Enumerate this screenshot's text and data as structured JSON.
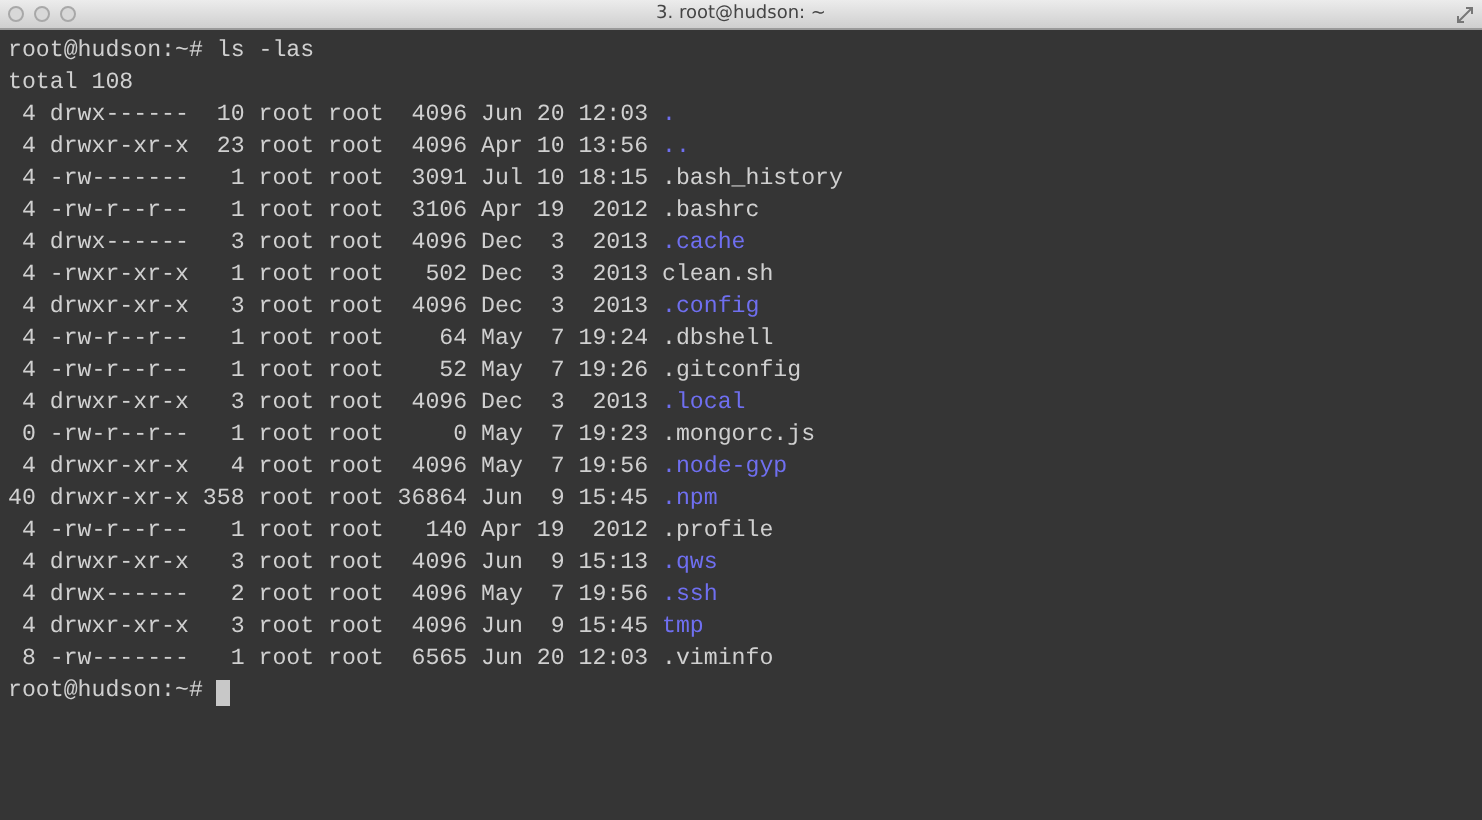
{
  "window": {
    "title": "3. root@hudson: ~"
  },
  "terminal": {
    "command_prompt": "root@hudson:~#",
    "command": "ls -las",
    "total": "total 108",
    "entries": [
      {
        "info": " 4 drwx------  10 root root  4096 Jun 20 12:03 ",
        "name": ".",
        "kind": "directory"
      },
      {
        "info": " 4 drwxr-xr-x  23 root root  4096 Apr 10 13:56 ",
        "name": "..",
        "kind": "directory"
      },
      {
        "info": " 4 -rw-------   1 root root  3091 Jul 10 18:15 ",
        "name": ".bash_history",
        "kind": "file"
      },
      {
        "info": " 4 -rw-r--r--   1 root root  3106 Apr 19  2012 ",
        "name": ".bashrc",
        "kind": "file"
      },
      {
        "info": " 4 drwx------   3 root root  4096 Dec  3  2013 ",
        "name": ".cache",
        "kind": "directory"
      },
      {
        "info": " 4 -rwxr-xr-x   1 root root   502 Dec  3  2013 ",
        "name": "clean.sh",
        "kind": "file"
      },
      {
        "info": " 4 drwxr-xr-x   3 root root  4096 Dec  3  2013 ",
        "name": ".config",
        "kind": "directory"
      },
      {
        "info": " 4 -rw-r--r--   1 root root    64 May  7 19:24 ",
        "name": ".dbshell",
        "kind": "file"
      },
      {
        "info": " 4 -rw-r--r--   1 root root    52 May  7 19:26 ",
        "name": ".gitconfig",
        "kind": "file"
      },
      {
        "info": " 4 drwxr-xr-x   3 root root  4096 Dec  3  2013 ",
        "name": ".local",
        "kind": "directory"
      },
      {
        "info": " 0 -rw-r--r--   1 root root     0 May  7 19:23 ",
        "name": ".mongorc.js",
        "kind": "file"
      },
      {
        "info": " 4 drwxr-xr-x   4 root root  4096 May  7 19:56 ",
        "name": ".node-gyp",
        "kind": "directory"
      },
      {
        "info": "40 drwxr-xr-x 358 root root 36864 Jun  9 15:45 ",
        "name": ".npm",
        "kind": "directory"
      },
      {
        "info": " 4 -rw-r--r--   1 root root   140 Apr 19  2012 ",
        "name": ".profile",
        "kind": "file"
      },
      {
        "info": " 4 drwxr-xr-x   3 root root  4096 Jun  9 15:13 ",
        "name": ".qws",
        "kind": "directory"
      },
      {
        "info": " 4 drwx------   2 root root  4096 May  7 19:56 ",
        "name": ".ssh",
        "kind": "directory"
      },
      {
        "info": " 4 drwxr-xr-x   3 root root  4096 Jun  9 15:45 ",
        "name": "tmp",
        "kind": "directory"
      },
      {
        "info": " 8 -rw-------   1 root root  6565 Jun 20 12:03 ",
        "name": ".viminfo",
        "kind": "file"
      }
    ],
    "final_prompt": "root@hudson:~#"
  }
}
